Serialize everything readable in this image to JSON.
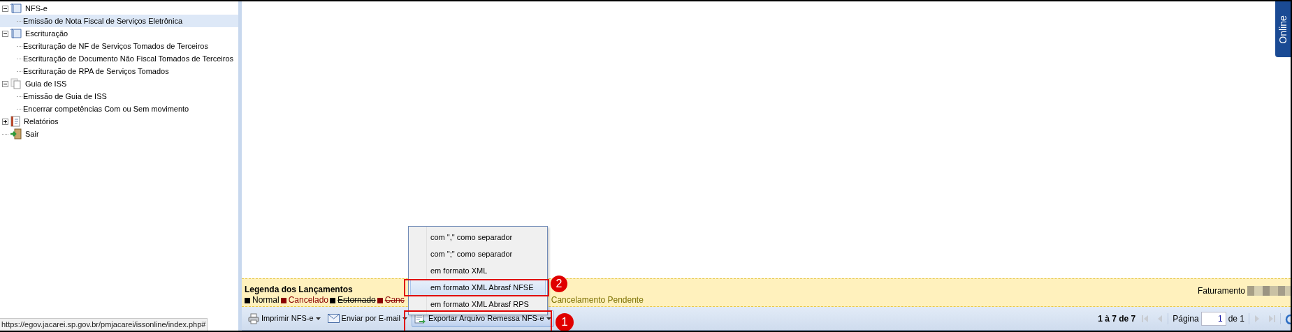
{
  "tree": [
    {
      "label": "NFS-e",
      "kind": "document",
      "expanded": true,
      "selected": false,
      "children": [
        {
          "label": "Emissão de Nota Fiscal de Serviços Eletrônica",
          "selected": true
        }
      ]
    },
    {
      "label": "Escrituração",
      "kind": "document",
      "expanded": true,
      "selected": false,
      "children": [
        {
          "label": "Escrituração de NF de Serviços Tomados de Terceiros",
          "selected": false
        },
        {
          "label": "Escrituração de Documento Não Fiscal Tomados de Terceiros",
          "selected": false
        },
        {
          "label": "Escrituração de RPA de Serviços Tomados",
          "selected": false
        }
      ]
    },
    {
      "label": "Guia de ISS",
      "kind": "pages",
      "expanded": true,
      "selected": false,
      "children": [
        {
          "label": "Emissão de Guia de ISS",
          "selected": false
        },
        {
          "label": "Encerrar competências Com ou Sem movimento",
          "selected": false
        }
      ]
    },
    {
      "label": "Relatórios",
      "kind": "report",
      "expanded": false,
      "selected": false
    },
    {
      "label": "Sair",
      "kind": "exit",
      "selected": false
    }
  ],
  "status_url": "https://egov.jacarei.sp.gov.br/pmjacarei/issonline/index.php#",
  "online_tab": "Online",
  "legend": {
    "title": "Legenda dos Lançamentos",
    "faturamento_label": "Faturamento",
    "items": [
      {
        "label": "Normal",
        "kind": "plain",
        "color": "#000000"
      },
      {
        "label": "Cancelado",
        "kind": "plain",
        "color": "#8b0000"
      },
      {
        "label": "Estornado",
        "kind": "struck",
        "color": "#000000"
      },
      {
        "label": "Canc",
        "kind": "struck",
        "color": "#8b0000"
      },
      {
        "label": "Cancelamento Pendente",
        "kind": "text",
        "color": "#7d7000"
      }
    ]
  },
  "toolbar": {
    "buttons": [
      {
        "label": "Imprimir NFS-e",
        "pressed": false
      },
      {
        "label": "Enviar por E-mail",
        "pressed": false
      },
      {
        "label": "Exportar Arquivo Remessa NFS-e",
        "pressed": true
      }
    ]
  },
  "export_menu": {
    "items": [
      {
        "label": "com \",\" como separador",
        "selected": false
      },
      {
        "label": "com \";\" como separador",
        "selected": false
      },
      {
        "label": "em formato XML",
        "selected": false
      },
      {
        "label": "em formato XML Abrasf NFSE",
        "selected": true
      },
      {
        "label": "em formato XML Abrasf RPS",
        "selected": false
      }
    ]
  },
  "pager": {
    "summary": "1 à 7 de 7",
    "page_label": "Página",
    "page": "1",
    "of": "de 1"
  },
  "annotations": [
    {
      "number": "1"
    },
    {
      "number": "2"
    }
  ]
}
